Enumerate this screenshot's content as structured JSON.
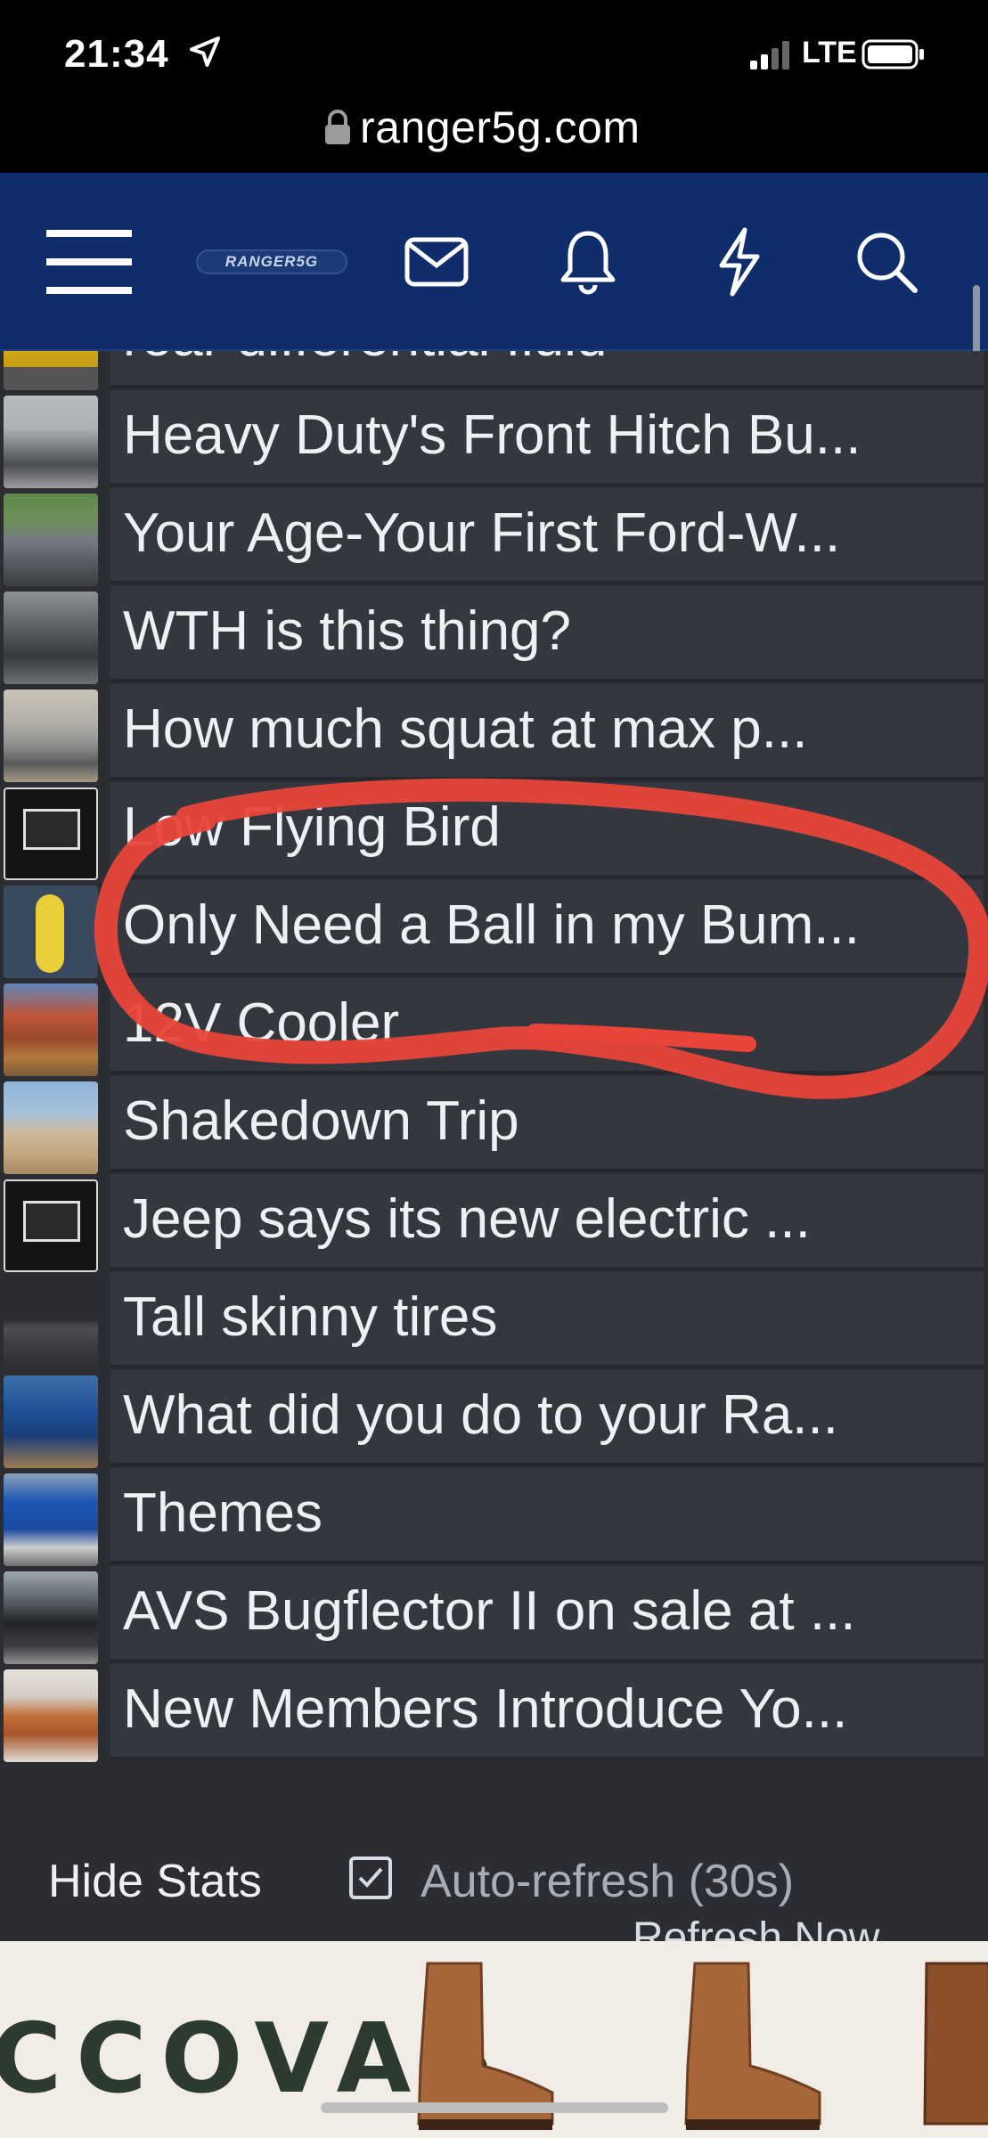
{
  "status_bar": {
    "time": "21:34",
    "network": "LTE"
  },
  "browser": {
    "url": "ranger5g.com"
  },
  "header": {
    "logo_text": "RANGER5G"
  },
  "threads": [
    {
      "title": "rear differential fluid",
      "thumb": "yellow-truck"
    },
    {
      "title": "Heavy Duty's Front Hitch Bu...",
      "thumb": "silver-truck"
    },
    {
      "title": "Your Age-Your First Ford-W...",
      "thumb": "gray-truck"
    },
    {
      "title": "WTH is this thing?",
      "thumb": "dark-truck"
    },
    {
      "title": "How much squat at max p...",
      "thumb": "white-truck"
    },
    {
      "title": "Low Flying Bird",
      "thumb": "placeholder-photo"
    },
    {
      "title": "Only Need a Ball in my Bum...",
      "thumb": "banana-figure"
    },
    {
      "title": "12V Cooler",
      "thumb": "desert-red-truck"
    },
    {
      "title": "Shakedown Trip",
      "thumb": "desert-white-truck"
    },
    {
      "title": "Jeep says its new electric ...",
      "thumb": "placeholder-photo"
    },
    {
      "title": "Tall skinny tires",
      "thumb": "night-truck"
    },
    {
      "title": "What did you do to your Ra...",
      "thumb": "blue-truck"
    },
    {
      "title": "Themes",
      "thumb": "blue-truck-front"
    },
    {
      "title": "AVS Bugflector II on sale at ...",
      "thumb": "black-truck"
    },
    {
      "title": "New Members Introduce Yo...",
      "thumb": "orange-truck"
    }
  ],
  "footer": {
    "hide_stats": "Hide Stats",
    "auto_refresh": "Auto-refresh (30s)",
    "auto_refresh_checked": true,
    "refresh_now": "Refresh Now"
  },
  "ad": {
    "brand_text": "CCOVAS"
  },
  "colors": {
    "header_bg": "#0f2d6b",
    "row_bg": "#34373e",
    "annotation": "#e8443a"
  }
}
